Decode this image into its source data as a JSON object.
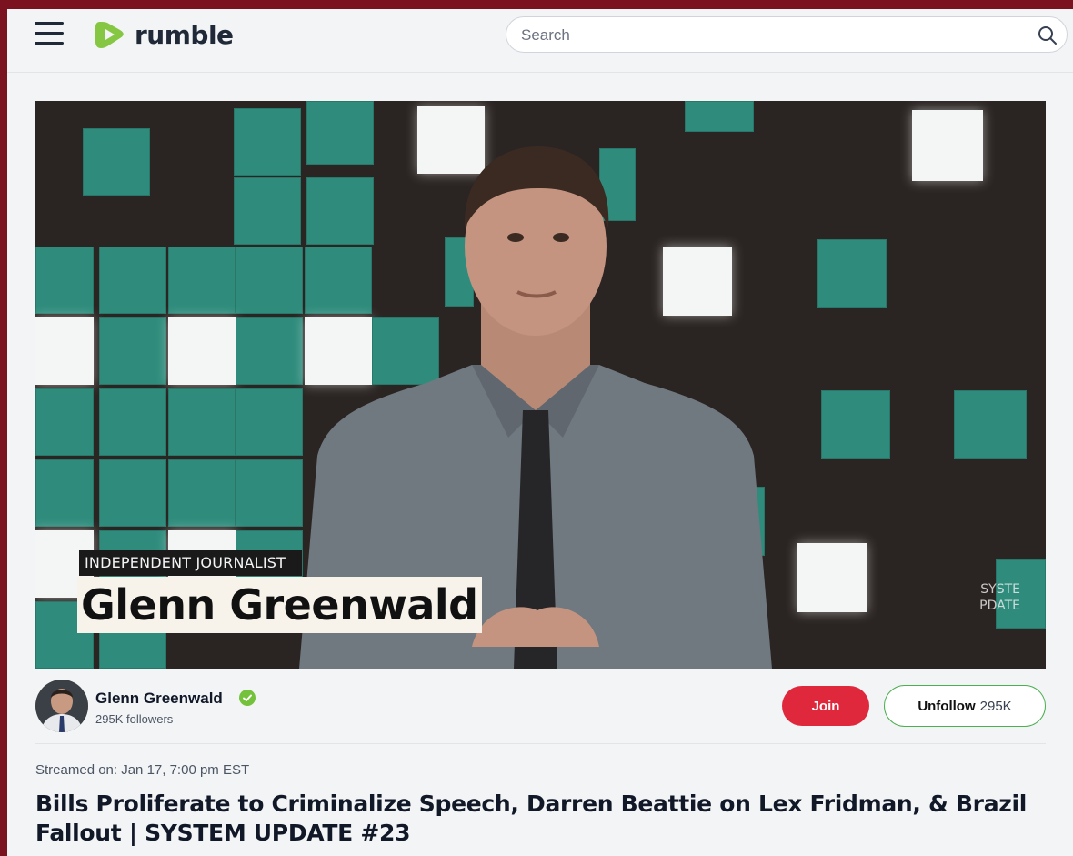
{
  "header": {
    "logo_text": "rumble",
    "search_placeholder": "Search"
  },
  "video": {
    "lower_third_tag": "INDEPENDENT JOURNALIST",
    "lower_third_name": "Glenn Greenwald",
    "watermark_line1": "SYSTE",
    "watermark_line2": "PDATE"
  },
  "channel": {
    "name": "Glenn Greenwald",
    "followers": "295K followers",
    "join_label": "Join",
    "unfollow_label": "Unfollow",
    "unfollow_count": "295K"
  },
  "meta": {
    "streamed": "Streamed on: Jan 17, 7:00 pm EST"
  },
  "title": "Bills Proliferate to Criminalize Speech, Darren Beattie on Lex Fridman, & Brazil Fallout | SYSTEM UPDATE #23",
  "colors": {
    "brand_green": "#85c742",
    "join_red": "#e0283c",
    "verified_green": "#74c23b",
    "frame": "#7a1220"
  },
  "icons": [
    "menu-icon",
    "rumble-logo-icon",
    "search-icon",
    "verified-icon"
  ]
}
